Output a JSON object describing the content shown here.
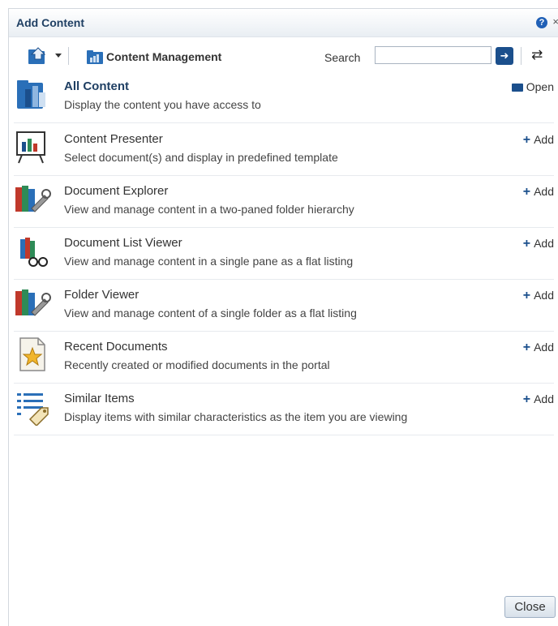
{
  "dialog": {
    "title": "Add Content",
    "help_icon": "?",
    "close_icon": "×"
  },
  "toolbar": {
    "breadcrumb_label": "Content Management",
    "search_label": "Search",
    "search_value": "",
    "search_go_icon": "➜",
    "refresh_icon": "⇄"
  },
  "items": [
    {
      "name": "All Content",
      "description": "Display the content you have access to",
      "action": "Open",
      "icon": "content-folder-icon"
    },
    {
      "name": "Content Presenter",
      "description": "Select document(s) and display in predefined template",
      "action": "Add",
      "icon": "presenter-icon"
    },
    {
      "name": "Document Explorer",
      "description": "View and manage content in a two-paned folder hierarchy",
      "action": "Add",
      "icon": "books-wrench-icon"
    },
    {
      "name": "Document List Viewer",
      "description": "View and manage content in a single pane as a flat listing",
      "action": "Add",
      "icon": "books-glasses-icon"
    },
    {
      "name": "Folder Viewer",
      "description": "View and manage content of a single folder as a flat listing",
      "action": "Add",
      "icon": "books-wrench-icon"
    },
    {
      "name": "Recent Documents",
      "description": "Recently created or modified documents in the portal",
      "action": "Add",
      "icon": "star-document-icon"
    },
    {
      "name": "Similar Items",
      "description": "Display items with similar characteristics as the item you are viewing",
      "action": "Add",
      "icon": "list-tag-icon"
    }
  ],
  "footer": {
    "close_label": "Close"
  },
  "colors": {
    "accent": "#1b4f8c",
    "title": "#1f3f63",
    "border": "#d3d8de"
  }
}
